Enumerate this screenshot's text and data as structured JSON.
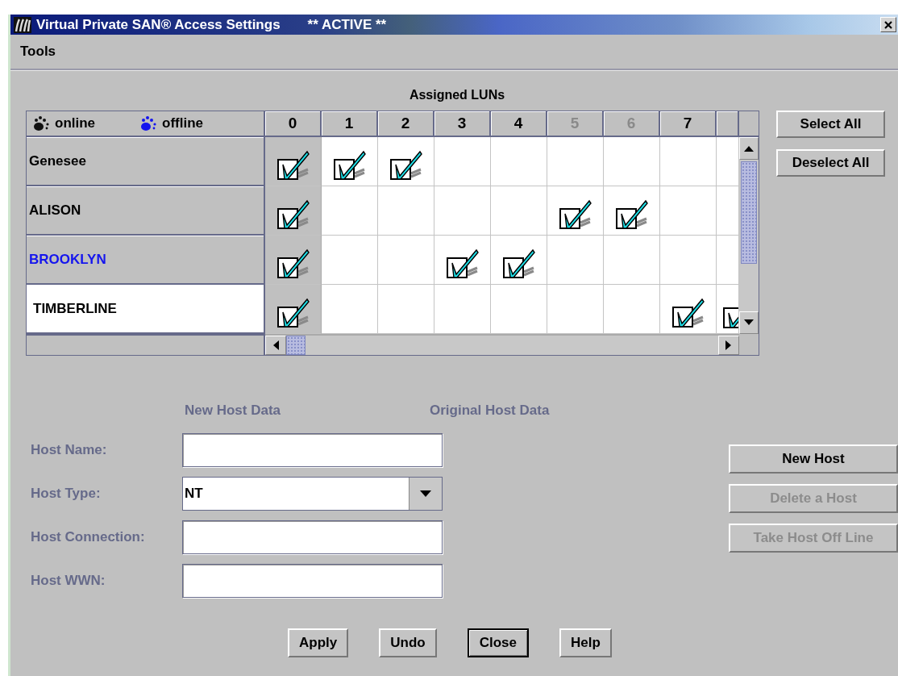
{
  "window": {
    "title": "Virtual Private SAN® Access Settings",
    "status": "** ACTIVE **"
  },
  "menu": [
    "Tools"
  ],
  "luns_title": "Assigned LUNs",
  "legend": [
    {
      "label": "online",
      "kind": "online"
    },
    {
      "label": "offline",
      "kind": "offline"
    }
  ],
  "columns": [
    {
      "label": "0",
      "disabled": false
    },
    {
      "label": "1",
      "disabled": false
    },
    {
      "label": "2",
      "disabled": false
    },
    {
      "label": "3",
      "disabled": false
    },
    {
      "label": "4",
      "disabled": false
    },
    {
      "label": "5",
      "disabled": true
    },
    {
      "label": "6",
      "disabled": true
    },
    {
      "label": "7",
      "disabled": false
    },
    {}
  ],
  "hosts": [
    {
      "name": "Genesee",
      "offline": false,
      "selected": false,
      "luns": [
        true,
        true,
        true,
        false,
        false,
        false,
        false,
        false,
        false
      ]
    },
    {
      "name": "ALISON",
      "offline": false,
      "selected": false,
      "luns": [
        true,
        false,
        false,
        false,
        false,
        true,
        true,
        false,
        false
      ]
    },
    {
      "name": "BROOKLYN",
      "offline": true,
      "selected": false,
      "luns": [
        true,
        false,
        false,
        true,
        true,
        false,
        false,
        false,
        false
      ]
    },
    {
      "name": "TIMBERLINE",
      "offline": false,
      "selected": true,
      "luns": [
        true,
        false,
        false,
        false,
        false,
        false,
        false,
        true,
        true
      ]
    }
  ],
  "grid_buttons": [
    {
      "label": "Select All",
      "disabled": false
    },
    {
      "label": "Deselect All",
      "disabled": false
    }
  ],
  "headings": [
    "New Host Data",
    "Original Host Data"
  ],
  "fields": [
    {
      "label": "Host Name:",
      "kind": "text"
    },
    {
      "label": "Host Type:",
      "kind": "dropdown",
      "value": "NT"
    },
    {
      "label": "Host Connection:",
      "kind": "text"
    },
    {
      "label": "Host WWN:",
      "kind": "text"
    }
  ],
  "host_buttons": [
    {
      "label": "New Host",
      "disabled": false
    },
    {
      "label": "Delete a Host",
      "disabled": true
    },
    {
      "label": "Take Host Off Line",
      "disabled": true
    }
  ],
  "buttons": [
    {
      "label": "Apply",
      "default": false
    },
    {
      "label": "Undo",
      "default": false
    },
    {
      "label": "Close",
      "default": true
    },
    {
      "label": "Help",
      "default": false
    }
  ]
}
